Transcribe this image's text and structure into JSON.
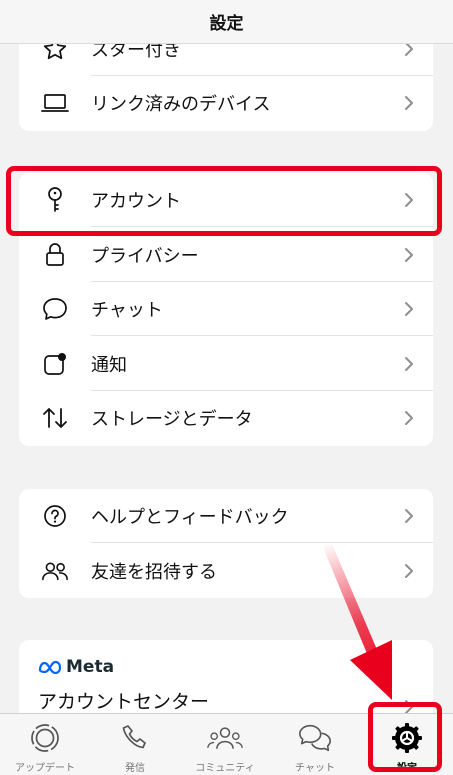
{
  "header": {
    "title": "設定"
  },
  "group1": {
    "items": [
      {
        "label": "スター付き",
        "icon": "star-icon"
      },
      {
        "label": "リンク済みのデバイス",
        "icon": "laptop-icon"
      }
    ]
  },
  "group2": {
    "items": [
      {
        "label": "アカウント",
        "icon": "key-icon"
      },
      {
        "label": "プライバシー",
        "icon": "lock-icon"
      },
      {
        "label": "チャット",
        "icon": "chat-bubble-icon"
      },
      {
        "label": "通知",
        "icon": "notification-icon"
      },
      {
        "label": "ストレージとデータ",
        "icon": "storage-arrows-icon"
      }
    ]
  },
  "group3": {
    "items": [
      {
        "label": "ヘルプとフィードバック",
        "icon": "help-icon"
      },
      {
        "label": "友達を招待する",
        "icon": "people-icon"
      }
    ]
  },
  "meta": {
    "brand": "Meta",
    "title": "アカウントセンター"
  },
  "tabbar": {
    "tabs": [
      {
        "label": "アップデート",
        "icon": "updates-icon"
      },
      {
        "label": "発信",
        "icon": "phone-icon"
      },
      {
        "label": "コミュニティ",
        "icon": "community-icon"
      },
      {
        "label": "チャット",
        "icon": "chats-icon"
      },
      {
        "label": "設定",
        "icon": "settings-gear-icon",
        "active": true
      }
    ]
  },
  "colors": {
    "highlight": "#e8001c",
    "meta_blue": "#0866ff",
    "chevron": "#8e8e93"
  }
}
